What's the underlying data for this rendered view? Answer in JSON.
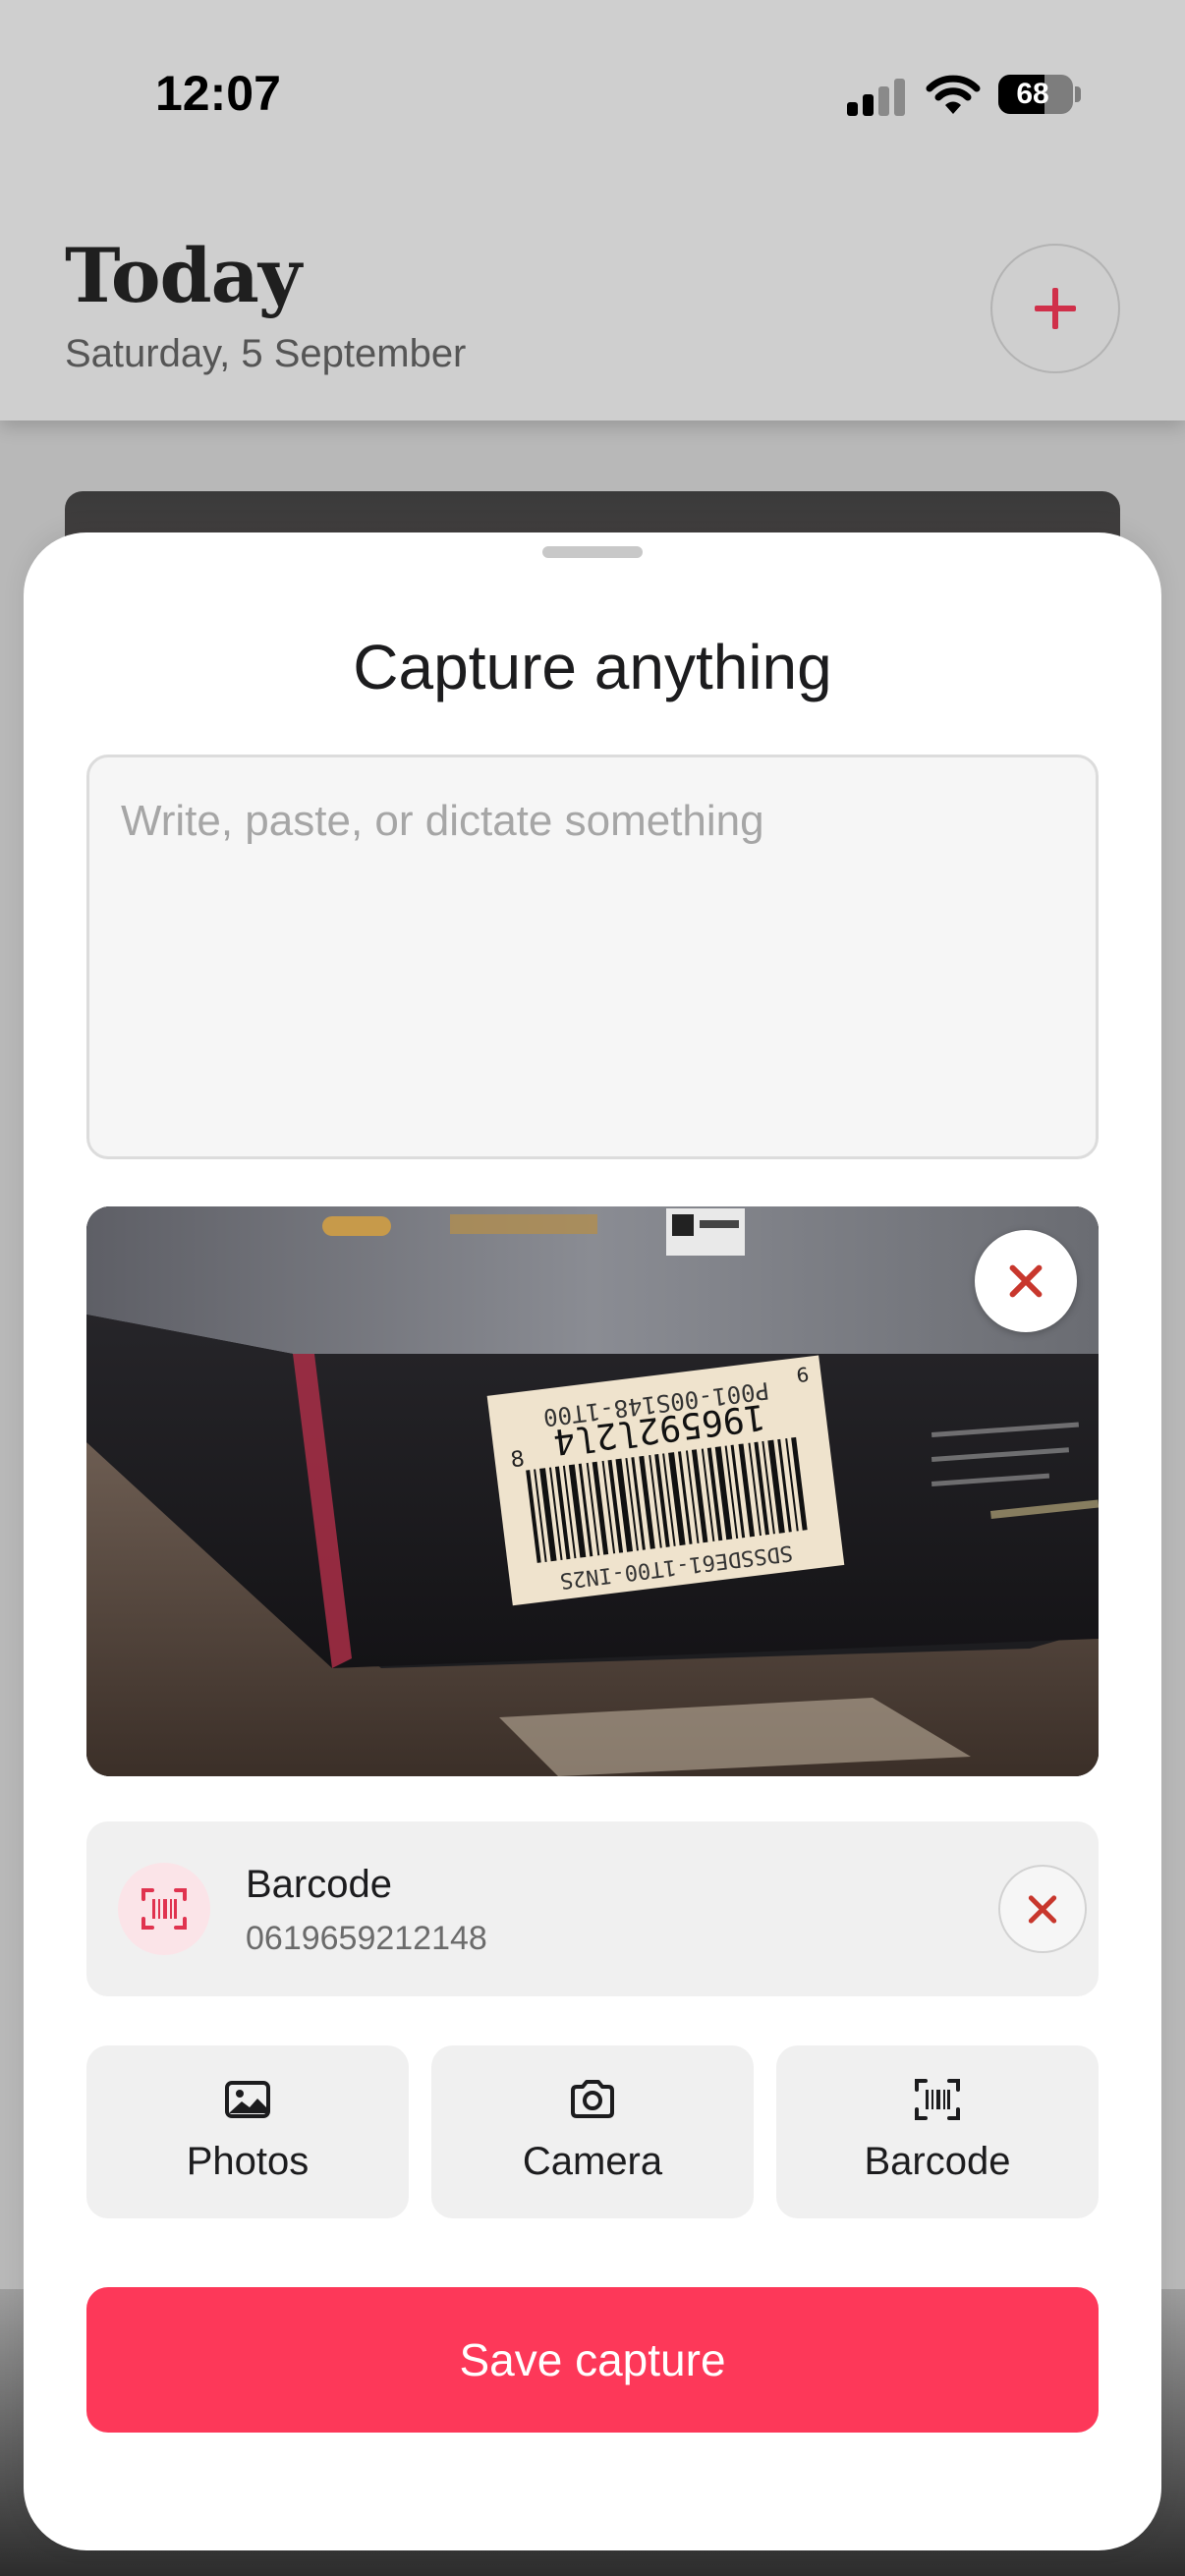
{
  "status_bar": {
    "time": "12:07",
    "battery_percent": "68",
    "battery_level": 0.68,
    "signal_bars_active": 2,
    "signal_bars_total": 4
  },
  "background_screen": {
    "title": "Today",
    "date": "Saturday, 5 September",
    "add_icon": "plus-icon"
  },
  "capture_sheet": {
    "title": "Capture anything",
    "text_input": {
      "value": "",
      "placeholder": "Write, paste, or dictate something"
    },
    "attached_photo": {
      "remove_icon": "close-icon",
      "label_text": [
        "P001-00S148-1T00",
        "196592l2l4",
        "SDSSDE61-1T00-IN2S",
        "8",
        "6"
      ]
    },
    "barcode": {
      "label": "Barcode",
      "value": "0619659212148",
      "icon": "barcode-scan-icon",
      "remove_icon": "close-icon"
    },
    "sources": [
      {
        "label": "Photos",
        "icon": "image-icon"
      },
      {
        "label": "Camera",
        "icon": "camera-icon"
      },
      {
        "label": "Barcode",
        "icon": "barcode-scan-icon"
      }
    ],
    "save_label": "Save capture"
  },
  "colors": {
    "accent": "#fd3859",
    "remove_x": "#c8372d",
    "badge_bg": "#fbe4e8",
    "sheet_bg": "#ffffff",
    "card_bg": "#f0f0f0"
  }
}
